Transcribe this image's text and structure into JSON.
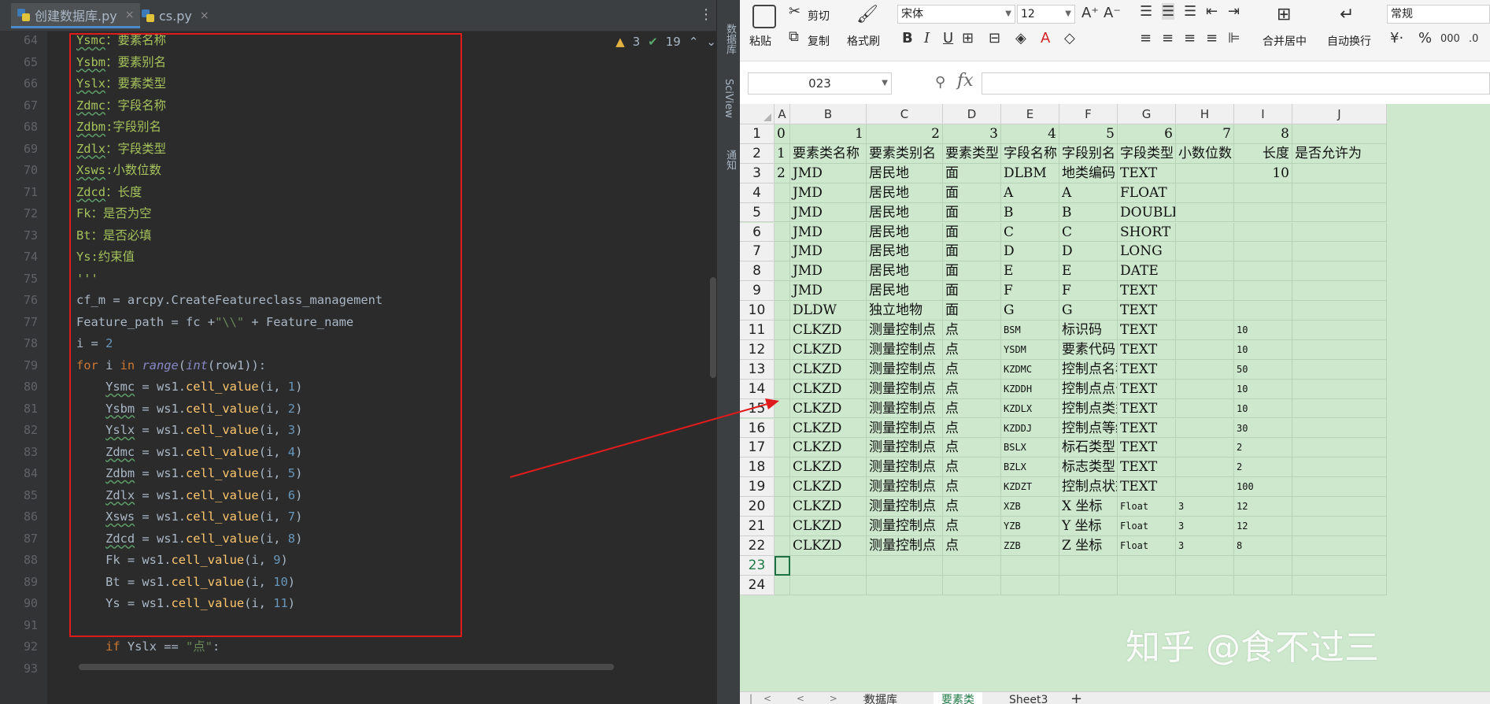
{
  "ide": {
    "tabs": [
      {
        "label": "创建数据库.py",
        "active": true
      },
      {
        "label": "cs.py",
        "active": false
      }
    ],
    "inspection": {
      "warnings": "3",
      "weak_warnings": "19"
    },
    "lines": [
      {
        "no": "64",
        "segs": [
          [
            "cm ul",
            "Ysmc"
          ],
          [
            "cm",
            "：要素名称"
          ]
        ]
      },
      {
        "no": "65",
        "segs": [
          [
            "cm ul",
            "Ysbm"
          ],
          [
            "cm",
            "：要素别名"
          ]
        ]
      },
      {
        "no": "66",
        "segs": [
          [
            "cm ul",
            "Yslx"
          ],
          [
            "cm",
            "：要素类型"
          ]
        ]
      },
      {
        "no": "67",
        "segs": [
          [
            "cm ul",
            "Zdmc"
          ],
          [
            "cm",
            "：字段名称"
          ]
        ]
      },
      {
        "no": "68",
        "segs": [
          [
            "cm ul",
            "Zdbm"
          ],
          [
            "cm",
            ":字段别名"
          ]
        ]
      },
      {
        "no": "69",
        "segs": [
          [
            "cm ul",
            "Zdlx"
          ],
          [
            "cm",
            "：字段类型"
          ]
        ]
      },
      {
        "no": "70",
        "segs": [
          [
            "cm ul",
            "Xsws"
          ],
          [
            "cm",
            ":小数位数"
          ]
        ]
      },
      {
        "no": "71",
        "segs": [
          [
            "cm ul",
            "Zdcd"
          ],
          [
            "cm",
            "：长度"
          ]
        ]
      },
      {
        "no": "72",
        "segs": [
          [
            "cm",
            "Fk：是否为空"
          ]
        ]
      },
      {
        "no": "73",
        "segs": [
          [
            "cm",
            "Bt：是否必填"
          ]
        ]
      },
      {
        "no": "74",
        "segs": [
          [
            "cm",
            "Ys:约束值"
          ]
        ]
      },
      {
        "no": "75",
        "segs": [
          [
            "cm",
            "'''"
          ]
        ]
      },
      {
        "no": "76",
        "segs": [
          [
            "",
            "cf_m = arcpy.CreateFeatureclass_management"
          ]
        ]
      },
      {
        "no": "77",
        "segs": [
          [
            "",
            "Feature_path = fc +"
          ],
          [
            "str",
            "\"\\\\\""
          ],
          [
            "",
            " + Feature_name"
          ]
        ]
      },
      {
        "no": "78",
        "segs": [
          [
            "",
            "i = "
          ],
          [
            "num",
            "2"
          ]
        ]
      },
      {
        "no": "79",
        "segs": [
          [
            "kw",
            "for "
          ],
          [
            "",
            "i "
          ],
          [
            "kw",
            "in "
          ],
          [
            "bi",
            "range"
          ],
          [
            "",
            "("
          ],
          [
            "bi",
            "int"
          ],
          [
            "",
            "(row1)):"
          ]
        ]
      },
      {
        "no": "80",
        "segs": [
          [
            "",
            "    "
          ],
          [
            "ul",
            "Ysmc"
          ],
          [
            "",
            " = ws1."
          ],
          [
            "fn",
            "cell_value"
          ],
          [
            "",
            "(i, "
          ],
          [
            "num",
            "1"
          ],
          [
            "",
            ")"
          ]
        ]
      },
      {
        "no": "81",
        "segs": [
          [
            "",
            "    "
          ],
          [
            "ul",
            "Ysbm"
          ],
          [
            "",
            " = ws1."
          ],
          [
            "fn",
            "cell_value"
          ],
          [
            "",
            "(i, "
          ],
          [
            "num",
            "2"
          ],
          [
            "",
            ")"
          ]
        ]
      },
      {
        "no": "82",
        "segs": [
          [
            "",
            "    "
          ],
          [
            "ul",
            "Yslx"
          ],
          [
            "",
            " = ws1."
          ],
          [
            "fn",
            "cell_value"
          ],
          [
            "",
            "(i, "
          ],
          [
            "num",
            "3"
          ],
          [
            "",
            ")"
          ]
        ]
      },
      {
        "no": "83",
        "segs": [
          [
            "",
            "    "
          ],
          [
            "ul",
            "Zdmc"
          ],
          [
            "",
            " = ws1."
          ],
          [
            "fn",
            "cell_value"
          ],
          [
            "",
            "(i, "
          ],
          [
            "num",
            "4"
          ],
          [
            "",
            ")"
          ]
        ]
      },
      {
        "no": "84",
        "segs": [
          [
            "",
            "    "
          ],
          [
            "ul",
            "Zdbm"
          ],
          [
            "",
            " = ws1."
          ],
          [
            "fn",
            "cell_value"
          ],
          [
            "",
            "(i, "
          ],
          [
            "num",
            "5"
          ],
          [
            "",
            ")"
          ]
        ]
      },
      {
        "no": "85",
        "segs": [
          [
            "",
            "    "
          ],
          [
            "ul",
            "Zdlx"
          ],
          [
            "",
            " = ws1."
          ],
          [
            "fn",
            "cell_value"
          ],
          [
            "",
            "(i, "
          ],
          [
            "num",
            "6"
          ],
          [
            "",
            ")"
          ]
        ]
      },
      {
        "no": "86",
        "segs": [
          [
            "",
            "    "
          ],
          [
            "ul",
            "Xsws"
          ],
          [
            "",
            " = ws1."
          ],
          [
            "fn",
            "cell_value"
          ],
          [
            "",
            "(i, "
          ],
          [
            "num",
            "7"
          ],
          [
            "",
            ")"
          ]
        ]
      },
      {
        "no": "87",
        "segs": [
          [
            "",
            "    "
          ],
          [
            "ul",
            "Zdcd"
          ],
          [
            "",
            " = ws1."
          ],
          [
            "fn",
            "cell_value"
          ],
          [
            "",
            "(i, "
          ],
          [
            "num",
            "8"
          ],
          [
            "",
            ")"
          ]
        ]
      },
      {
        "no": "88",
        "segs": [
          [
            "",
            "    Fk = ws1."
          ],
          [
            "fn",
            "cell_value"
          ],
          [
            "",
            "(i, "
          ],
          [
            "num",
            "9"
          ],
          [
            "",
            ")"
          ]
        ]
      },
      {
        "no": "89",
        "segs": [
          [
            "",
            "    Bt = ws1."
          ],
          [
            "fn",
            "cell_value"
          ],
          [
            "",
            "(i, "
          ],
          [
            "num",
            "10"
          ],
          [
            "",
            ")"
          ]
        ]
      },
      {
        "no": "90",
        "segs": [
          [
            "",
            "    Ys = ws1."
          ],
          [
            "fn",
            "cell_value"
          ],
          [
            "",
            "(i, "
          ],
          [
            "num",
            "11"
          ],
          [
            "",
            ")"
          ]
        ]
      },
      {
        "no": "91",
        "segs": [
          [
            "",
            ""
          ]
        ]
      },
      {
        "no": "92",
        "segs": [
          [
            "",
            "    "
          ],
          [
            "kw",
            "if "
          ],
          [
            "",
            "Yslx == "
          ],
          [
            "str",
            "\"点\""
          ],
          [
            "",
            ":"
          ]
        ]
      },
      {
        "no": "93",
        "segs": [
          [
            "",
            ""
          ]
        ]
      }
    ]
  },
  "side_strip": {
    "items": [
      "数据库",
      "SciView",
      "通知"
    ]
  },
  "spreadsheet": {
    "ribbon": {
      "paste": "粘贴",
      "cut": "剪切",
      "copy": "复制",
      "format_painter": "格式刷",
      "font_name": "宋体",
      "font_size": "12",
      "merge_center": "合并居中",
      "wrap_text": "自动换行",
      "number_format": "常规"
    },
    "name_box": "023",
    "formula_label": "fx",
    "columns": [
      "A",
      "B",
      "C",
      "D",
      "E",
      "F",
      "G",
      "H",
      "I",
      "J"
    ],
    "rows": [
      {
        "no": "1",
        "cells": [
          "0",
          "1",
          "2",
          "3",
          "4",
          "5",
          "6",
          "7",
          "8",
          ""
        ]
      },
      {
        "no": "2",
        "cells": [
          "1",
          "要素类名称",
          "要素类别名",
          "要素类型",
          "字段名称",
          "字段别名",
          "字段类型",
          "小数位数",
          "长度",
          "是否允许为"
        ]
      },
      {
        "no": "3",
        "cells": [
          "2",
          "JMD",
          "居民地",
          "面",
          "DLBM",
          "地类编码",
          "TEXT",
          "",
          "10",
          ""
        ]
      },
      {
        "no": "4",
        "cells": [
          "",
          "JMD",
          "居民地",
          "面",
          "A",
          "A",
          "FLOAT",
          "",
          "",
          ""
        ]
      },
      {
        "no": "5",
        "cells": [
          "",
          "JMD",
          "居民地",
          "面",
          "B",
          "B",
          "DOUBLE",
          "",
          "",
          ""
        ]
      },
      {
        "no": "6",
        "cells": [
          "",
          "JMD",
          "居民地",
          "面",
          "C",
          "C",
          "SHORT",
          "",
          "",
          ""
        ]
      },
      {
        "no": "7",
        "cells": [
          "",
          "JMD",
          "居民地",
          "面",
          "D",
          "D",
          "LONG",
          "",
          "",
          ""
        ]
      },
      {
        "no": "8",
        "cells": [
          "",
          "JMD",
          "居民地",
          "面",
          "E",
          "E",
          "DATE",
          "",
          "",
          ""
        ]
      },
      {
        "no": "9",
        "cells": [
          "",
          "JMD",
          "居民地",
          "面",
          "F",
          "F",
          "TEXT",
          "",
          "",
          ""
        ]
      },
      {
        "no": "10",
        "cells": [
          "",
          "DLDW",
          "独立地物",
          "面",
          "G",
          "G",
          "TEXT",
          "",
          "",
          ""
        ]
      },
      {
        "no": "11",
        "cells": [
          "",
          "CLKZD",
          "测量控制点",
          "点",
          "BSM",
          "标识码",
          "TEXT",
          "",
          "10",
          ""
        ]
      },
      {
        "no": "12",
        "cells": [
          "",
          "CLKZD",
          "测量控制点",
          "点",
          "YSDM",
          "要素代码",
          "TEXT",
          "",
          "10",
          ""
        ]
      },
      {
        "no": "13",
        "cells": [
          "",
          "CLKZD",
          "测量控制点",
          "点",
          "KZDMC",
          "控制点名称",
          "TEXT",
          "",
          "50",
          ""
        ]
      },
      {
        "no": "14",
        "cells": [
          "",
          "CLKZD",
          "测量控制点",
          "点",
          "KZDDH",
          "控制点点号",
          "TEXT",
          "",
          "10",
          ""
        ]
      },
      {
        "no": "15",
        "cells": [
          "",
          "CLKZD",
          "测量控制点",
          "点",
          "KZDLX",
          "控制点类型",
          "TEXT",
          "",
          "10",
          ""
        ]
      },
      {
        "no": "16",
        "cells": [
          "",
          "CLKZD",
          "测量控制点",
          "点",
          "KZDDJ",
          "控制点等级",
          "TEXT",
          "",
          "30",
          ""
        ]
      },
      {
        "no": "17",
        "cells": [
          "",
          "CLKZD",
          "测量控制点",
          "点",
          "BSLX",
          "标石类型",
          "TEXT",
          "",
          "2",
          ""
        ]
      },
      {
        "no": "18",
        "cells": [
          "",
          "CLKZD",
          "测量控制点",
          "点",
          "BZLX",
          "标志类型",
          "TEXT",
          "",
          "2",
          ""
        ]
      },
      {
        "no": "19",
        "cells": [
          "",
          "CLKZD",
          "测量控制点",
          "点",
          "KZDZT",
          "控制点状态",
          "TEXT",
          "",
          "100",
          ""
        ]
      },
      {
        "no": "20",
        "cells": [
          "",
          "CLKZD",
          "测量控制点",
          "点",
          "XZB",
          "X 坐标",
          "Float",
          "3",
          "12",
          ""
        ]
      },
      {
        "no": "21",
        "cells": [
          "",
          "CLKZD",
          "测量控制点",
          "点",
          "YZB",
          "Y 坐标",
          "Float",
          "3",
          "12",
          ""
        ]
      },
      {
        "no": "22",
        "cells": [
          "",
          "CLKZD",
          "测量控制点",
          "点",
          "ZZB",
          "Z 坐标",
          "Float",
          "3",
          "8",
          ""
        ]
      },
      {
        "no": "23",
        "cells": [
          "",
          "",
          "",
          "",
          "",
          "",
          "",
          "",
          "",
          ""
        ]
      },
      {
        "no": "24",
        "cells": [
          "",
          "",
          "",
          "",
          "",
          "",
          "",
          "",
          "",
          ""
        ]
      }
    ],
    "sheet_tabs": [
      {
        "label": "数据库",
        "active": false
      },
      {
        "label": "要素类",
        "active": true
      },
      {
        "label": "Sheet3",
        "active": false
      }
    ],
    "add_sheet": "+"
  },
  "watermark": "知乎 @食不过三",
  "colors": {
    "annotation_red": "#e01b1b",
    "sheet_green": "#cde8cd",
    "active_tab_green": "#1f7a45"
  }
}
